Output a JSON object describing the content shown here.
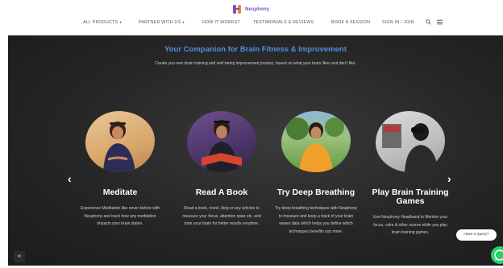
{
  "brand": {
    "name": "Neuphony"
  },
  "nav": {
    "items": [
      {
        "label": "ALL PRODUCTS",
        "has_caret": true
      },
      {
        "label": "PARTNER WITH US",
        "has_caret": true
      },
      {
        "label": "HOW IT WORKS?",
        "has_caret": false
      },
      {
        "label": "TESTIMONIALS & REVIEWS",
        "has_caret": false
      },
      {
        "label": "BOOK A SESSION",
        "has_caret": false
      },
      {
        "label": "SIGN IN / JOIN",
        "has_caret": false
      }
    ],
    "caret": "▾",
    "icons": [
      "search-icon",
      "menu-icon"
    ]
  },
  "hero": {
    "title": "Your Companion for Brain Fitness & Improvement",
    "subtitle": "Create you own brain training and well-being improvement journey; based on what your brain likes and don't like."
  },
  "cards": [
    {
      "title": "Meditate",
      "desc": "Experience Meditation like never before with Neuphony and track how any meditation impacts your brain states."
    },
    {
      "title": "Read A Book",
      "desc": "Read a book, novel, blog or any articles to measure your focus, attention span etc. and train your brain for better results evrytime."
    },
    {
      "title": "Try Deep Breathing",
      "desc": "Try deep breathing techniques with Neuphony to measure and keep a track of your brain waves data which helps you define which techniques benefits you more."
    },
    {
      "title": "Play Brain Training Games",
      "desc": "Use Neuphony Headband to Monitor your focus, calm & other scores while you play brain training games."
    }
  ],
  "controls": {
    "prev": "‹",
    "next": "›",
    "scroll_top": "«",
    "query_label": "Have a query?"
  },
  "colors": {
    "accent": "#4f8fde",
    "brand": "#7a4ec2",
    "whatsapp": "#25d366"
  }
}
